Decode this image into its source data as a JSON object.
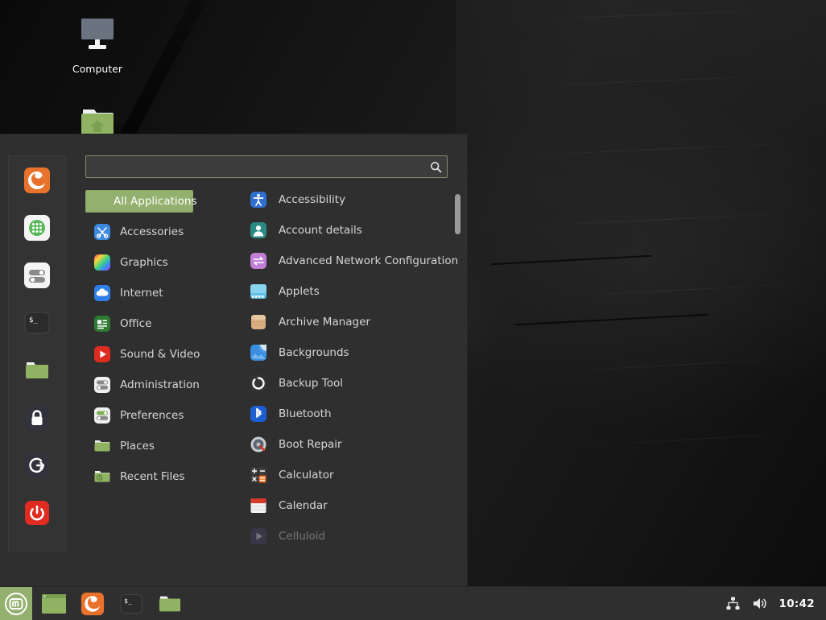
{
  "desktop": {
    "icons": [
      {
        "name": "computer",
        "label": "Computer",
        "icon": "computer-icon"
      },
      {
        "name": "home",
        "label": "",
        "icon": "home-folder-icon"
      }
    ]
  },
  "menu": {
    "search": {
      "value": "",
      "placeholder": "",
      "icon": "search-icon"
    },
    "favorites": [
      {
        "name": "firefox",
        "tooltip": "Firefox Web Browser",
        "icon": "firefox-icon"
      },
      {
        "name": "software-manager",
        "tooltip": "Software Manager",
        "icon": "software-manager-icon"
      },
      {
        "name": "system-settings",
        "tooltip": "System Settings",
        "icon": "settings-icon"
      },
      {
        "name": "terminal",
        "tooltip": "Terminal",
        "icon": "terminal-icon"
      },
      {
        "name": "files",
        "tooltip": "Files",
        "icon": "files-folder-icon"
      },
      {
        "name": "lock-screen",
        "tooltip": "Lock Screen",
        "icon": "lock-icon"
      },
      {
        "name": "log-out",
        "tooltip": "Log Out",
        "icon": "logout-icon"
      },
      {
        "name": "quit",
        "tooltip": "Quit",
        "icon": "power-icon"
      }
    ],
    "categories": [
      {
        "label": "All Applications",
        "icon": "none",
        "selected": true
      },
      {
        "label": "Accessories",
        "icon": "accessories-icon",
        "selected": false
      },
      {
        "label": "Graphics",
        "icon": "graphics-icon",
        "selected": false
      },
      {
        "label": "Internet",
        "icon": "internet-icon",
        "selected": false
      },
      {
        "label": "Office",
        "icon": "office-icon",
        "selected": false
      },
      {
        "label": "Sound & Video",
        "icon": "sound-video-icon",
        "selected": false
      },
      {
        "label": "Administration",
        "icon": "administration-icon",
        "selected": false
      },
      {
        "label": "Preferences",
        "icon": "preferences-icon",
        "selected": false
      },
      {
        "label": "Places",
        "icon": "places-icon",
        "selected": false
      },
      {
        "label": "Recent Files",
        "icon": "recent-files-icon",
        "selected": false
      }
    ],
    "applications": [
      {
        "label": "Accessibility",
        "icon": "accessibility-icon",
        "faded": false
      },
      {
        "label": "Account details",
        "icon": "account-details-icon",
        "faded": false
      },
      {
        "label": "Advanced Network Configuration",
        "icon": "network-config-icon",
        "faded": false
      },
      {
        "label": "Applets",
        "icon": "applets-icon",
        "faded": false
      },
      {
        "label": "Archive Manager",
        "icon": "archive-manager-icon",
        "faded": false
      },
      {
        "label": "Backgrounds",
        "icon": "backgrounds-icon",
        "faded": false
      },
      {
        "label": "Backup Tool",
        "icon": "backup-tool-icon",
        "faded": false
      },
      {
        "label": "Bluetooth",
        "icon": "bluetooth-icon",
        "faded": false
      },
      {
        "label": "Boot Repair",
        "icon": "boot-repair-icon",
        "faded": false
      },
      {
        "label": "Calculator",
        "icon": "calculator-icon",
        "faded": false
      },
      {
        "label": "Calendar",
        "icon": "calendar-icon",
        "faded": false
      },
      {
        "label": "Celluloid",
        "icon": "celluloid-icon",
        "faded": true
      }
    ],
    "scrollbar": {
      "thumb_top_pct": 1,
      "thumb_height_pct": 11
    }
  },
  "taskbar": {
    "menu_button": {
      "label": "Menu",
      "icon": "linux-mint-logo-icon"
    },
    "windows": [
      {
        "name": "show-desktop",
        "icon": "window-icon"
      },
      {
        "name": "firefox",
        "icon": "firefox-icon"
      },
      {
        "name": "terminal",
        "icon": "terminal-icon"
      },
      {
        "name": "files",
        "icon": "files-folder-icon"
      }
    ],
    "tray": [
      {
        "name": "network",
        "icon": "network-icon"
      },
      {
        "name": "volume",
        "icon": "volume-icon"
      }
    ],
    "clock": "10:42"
  },
  "colors": {
    "accent_green": "#93b06e",
    "panel_bg": "#2f2f2f",
    "text": "#d6d6d6"
  }
}
